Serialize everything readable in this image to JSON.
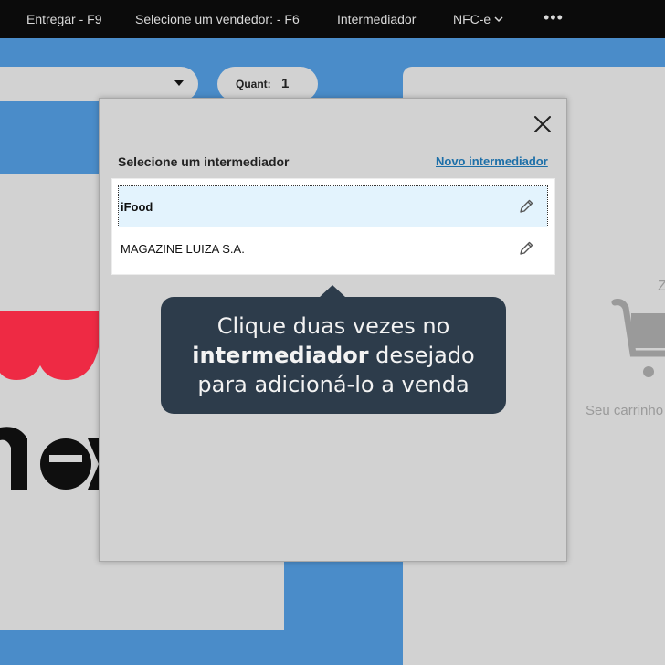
{
  "topbar": {
    "deliver": "Entregar - F9",
    "seller": "Selecione um vendedor: - F6",
    "intermediary": "Intermediador",
    "invoice_type": "NFC-e",
    "more": "•••"
  },
  "background": {
    "quantity_label": "Quant:",
    "quantity_value": "1",
    "cart_partial_letter": "Z",
    "cart_empty_text": "Seu carrinho"
  },
  "modal": {
    "title": "Selecione um intermediador",
    "new_link": "Novo intermediador",
    "items": [
      {
        "label": "iFood",
        "selected": true
      },
      {
        "label": "MAGAZINE LUIZA S.A.",
        "selected": false
      }
    ]
  },
  "tooltip": {
    "line1": "Clique duas vezes no",
    "line2_bold": "intermediador",
    "line2_rest": " desejado",
    "line3": "para adicioná-lo a venda"
  },
  "colors": {
    "topbar": "#0b0b0b",
    "accent_blue": "#4a8cc9",
    "dim_gray": "#d2d2d2",
    "link": "#1d6fa8",
    "selected_row": "#e3f3fd",
    "tooltip_bg": "#2d3c4b",
    "brand_red": "#ee2a44"
  }
}
